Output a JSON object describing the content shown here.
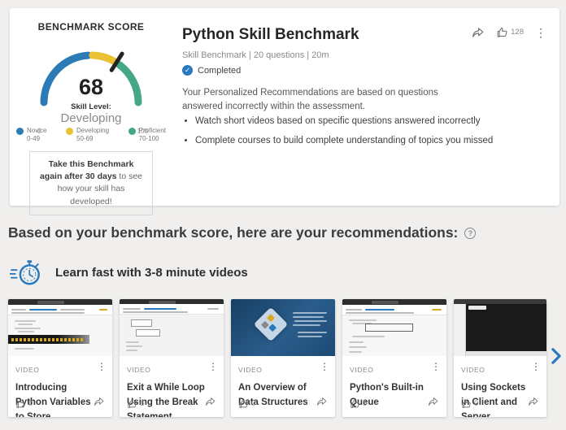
{
  "benchmark_card": {
    "score_panel": {
      "heading": "BENCHMARK SCORE",
      "score": "68",
      "skill_level_label": "Skill Level:",
      "skill_level_value": "Developing",
      "scale_min": "0",
      "scale_max": "100",
      "gauge": {
        "type": "gauge",
        "value": 68,
        "range": [
          0,
          100
        ],
        "segments": [
          {
            "name": "Novice",
            "range": "0-49",
            "color": "#2d7bb6"
          },
          {
            "name": "Developing",
            "range": "50-69",
            "color": "#e8c233"
          },
          {
            "name": "Proficient",
            "range": "70-100",
            "color": "#43a883"
          }
        ]
      },
      "legend": [
        {
          "name": "Novice",
          "range": "0-49",
          "color": "#2d7bb6"
        },
        {
          "name": "Developing",
          "range": "50-69",
          "color": "#e8c233"
        },
        {
          "name": "Proficient",
          "range": "70-100",
          "color": "#43a883"
        }
      ],
      "tip_bold": "Take this Benchmark again after 30 days",
      "tip_rest": " to see how your skill has developed!"
    },
    "details": {
      "title": "Python Skill Benchmark",
      "meta": "Skill Benchmark  |  20 questions  |  20m",
      "status": "Completed",
      "status_color": "#2879bd",
      "description": "Your Personalized Recommendations are based on questions answered incorrectly within the assessment.",
      "bullets": [
        "Watch short videos based on specific questions answered incorrectly",
        "Complete courses to build complete understanding of topics you missed"
      ]
    },
    "actions": {
      "likes": "128"
    }
  },
  "recommendations": {
    "heading": "Based on your benchmark score, here are your recommendations:",
    "subheading": "Learn fast with 3-8 minute videos",
    "accent_color": "#2879bd",
    "cards": [
      {
        "type": "VIDEO",
        "title": "Introducing Python Variables to Store",
        "likes": "0"
      },
      {
        "type": "VIDEO",
        "title": "Exit a While Loop Using the Break Statement",
        "likes": "6"
      },
      {
        "type": "VIDEO",
        "title": "An Overview of Data Structures",
        "likes": "0"
      },
      {
        "type": "VIDEO",
        "title": "Python's Built-in Queue",
        "likes": "0"
      },
      {
        "type": "VIDEO",
        "title": "Using Sockets in Client and Server",
        "likes": "0"
      }
    ]
  }
}
